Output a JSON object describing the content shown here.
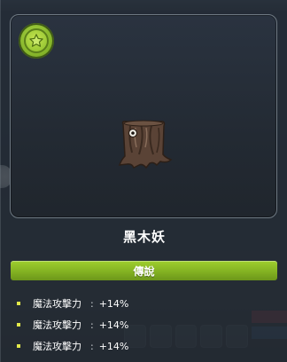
{
  "monster": {
    "name": "黑木妖",
    "rarity": "傳說",
    "rarity_color": "#86b52a",
    "badge_icon": "star-icon"
  },
  "stats": [
    {
      "name": "魔法攻擊力",
      "separator": ":",
      "value": "+14%"
    },
    {
      "name": "魔法攻擊力",
      "separator": ":",
      "value": "+14%"
    },
    {
      "name": "魔法攻擊力",
      "separator": ":",
      "value": "+14%"
    }
  ],
  "colors": {
    "panel_border": "#6f7a84",
    "bullet": "#e2e84a",
    "text": "#ffffff"
  }
}
